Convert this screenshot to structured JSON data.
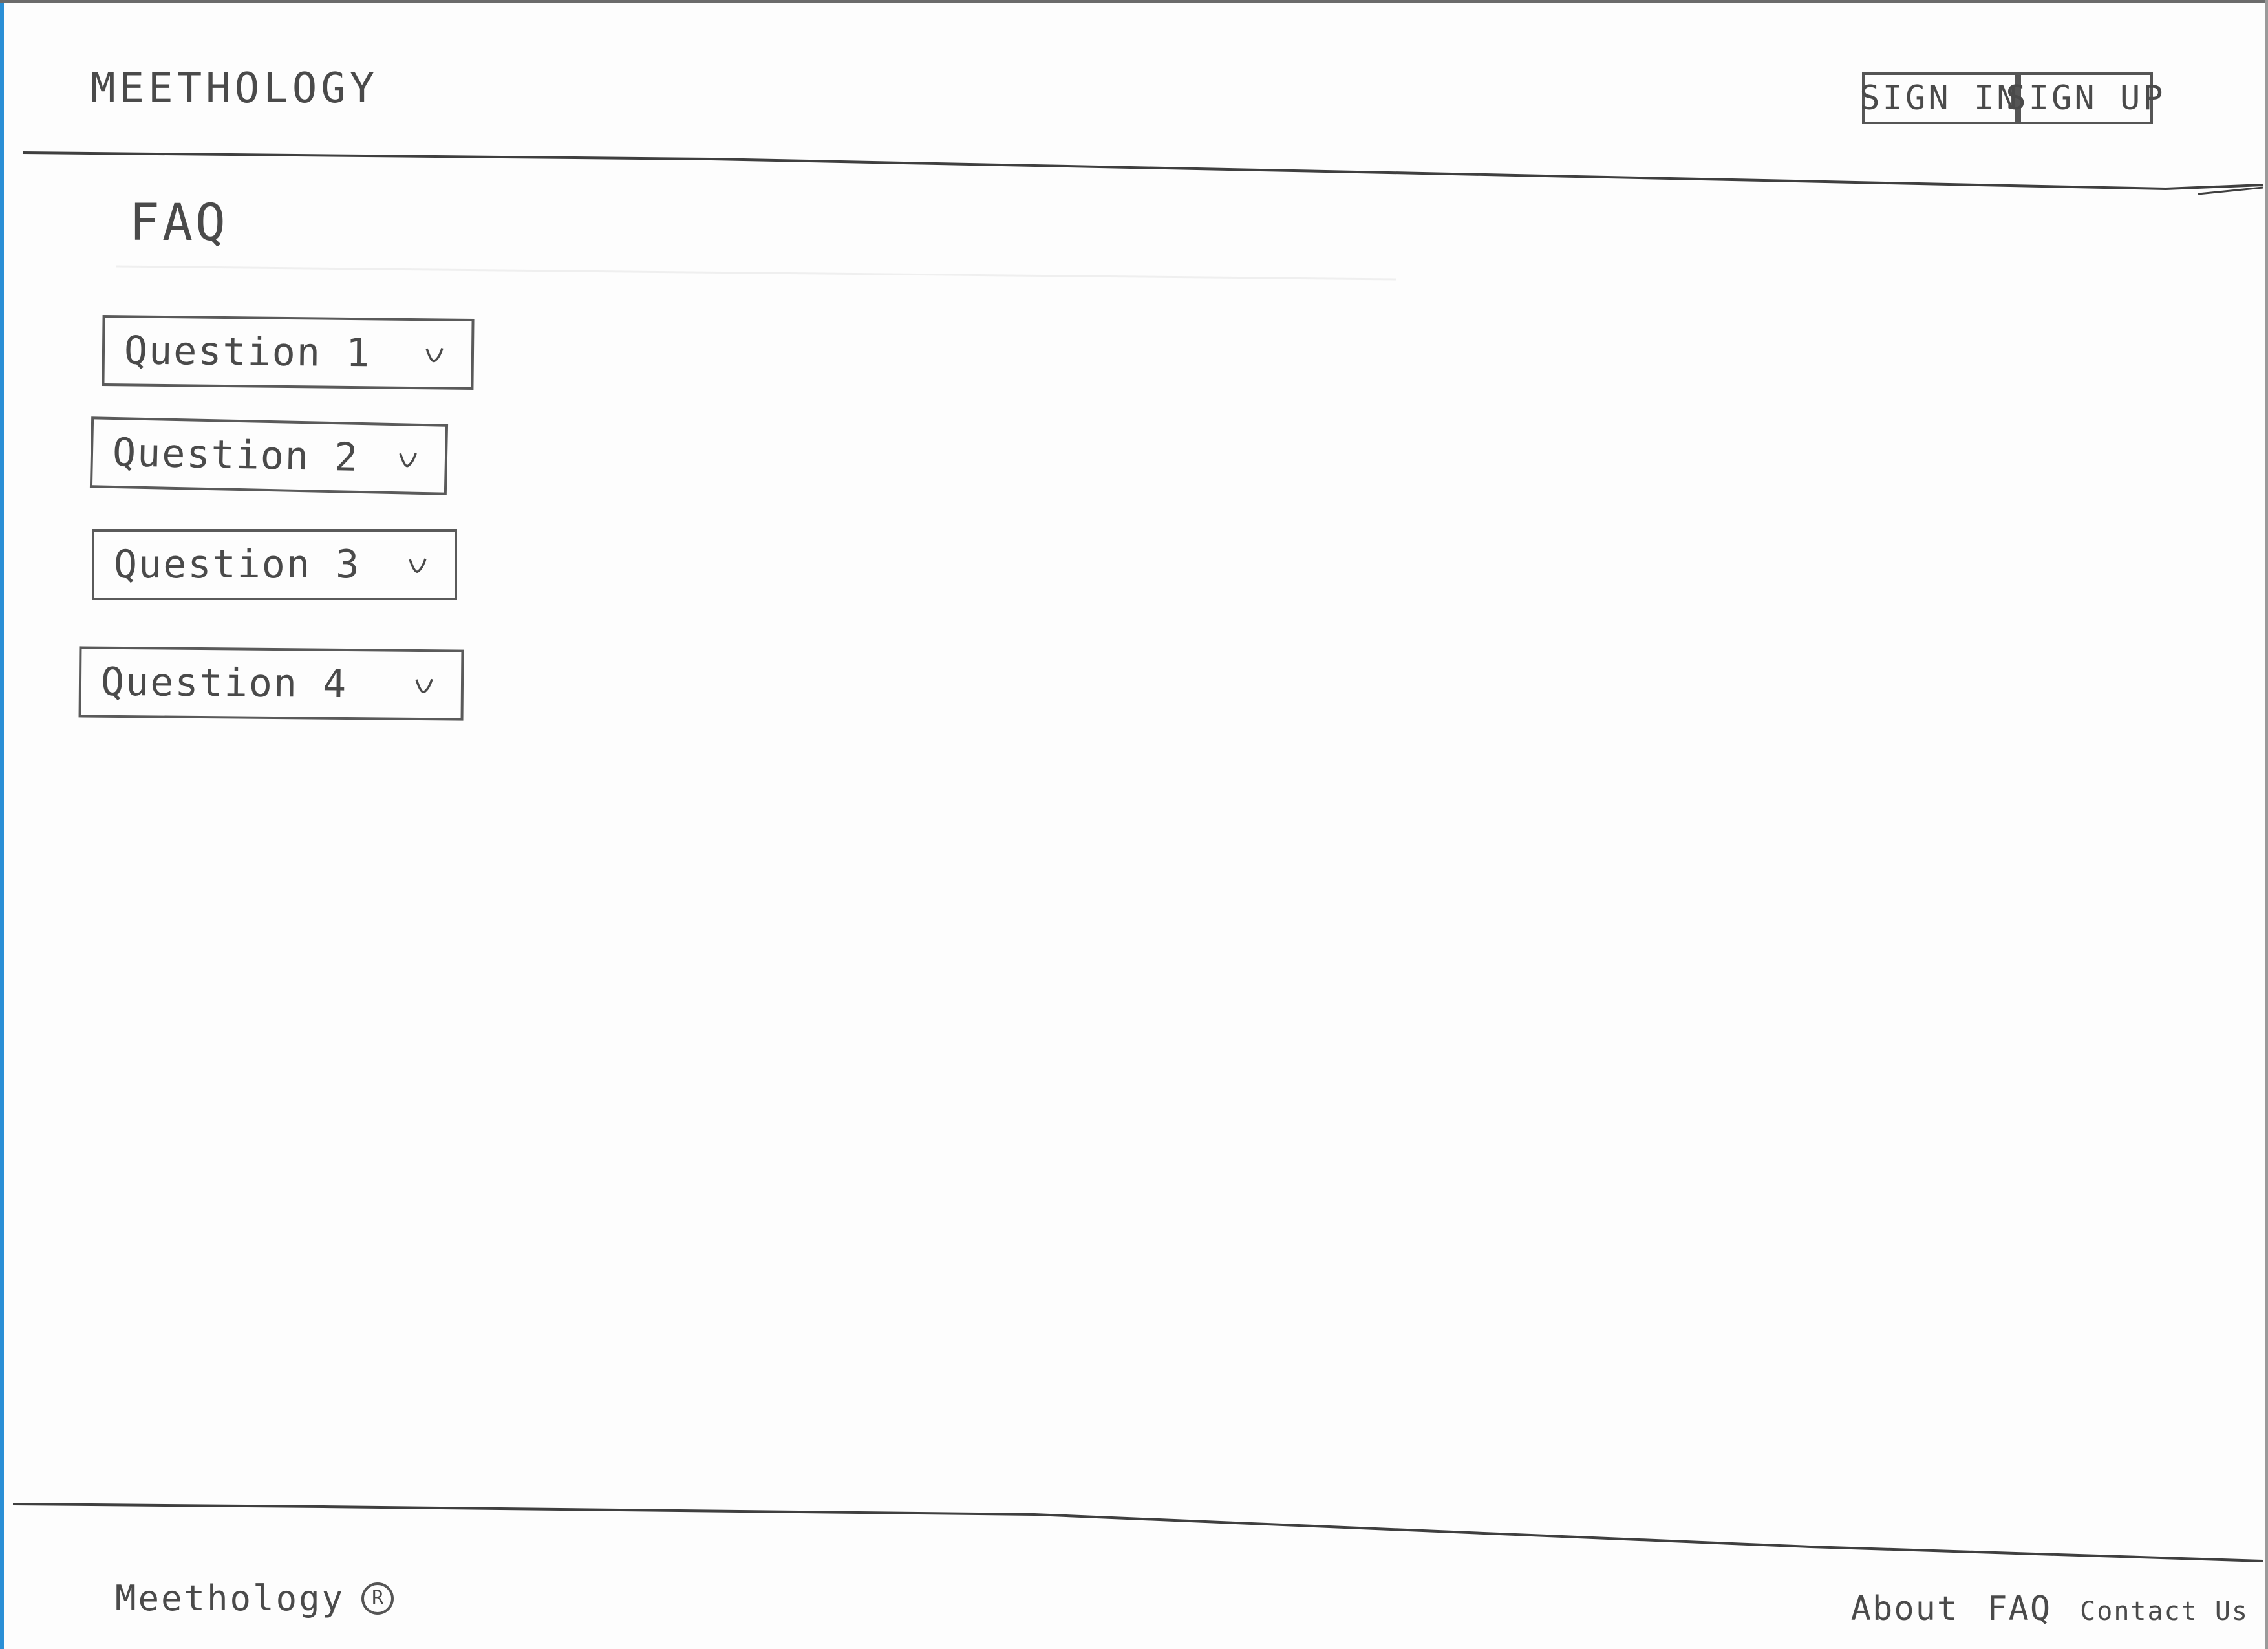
{
  "header": {
    "logo": "MEETHOLOGY",
    "sign_in": "SIGN IN",
    "sign_up": "SIGN UP"
  },
  "main": {
    "title": "FAQ",
    "questions": [
      {
        "label": "Question 1",
        "icon": "chevron-down-icon"
      },
      {
        "label": "Question 2",
        "icon": "chevron-down-icon"
      },
      {
        "label": "Question 3",
        "icon": "chevron-down-icon"
      },
      {
        "label": "Question 4",
        "icon": "chevron-down-icon"
      }
    ]
  },
  "footer": {
    "brand": "Meethology",
    "registered_mark": "R",
    "links": [
      "About",
      "FAQ",
      "Contact Us"
    ]
  },
  "colors": {
    "ink": "#4a4a4a",
    "paper": "#fdfdfd",
    "scan_edge": "#2a8fd6"
  }
}
